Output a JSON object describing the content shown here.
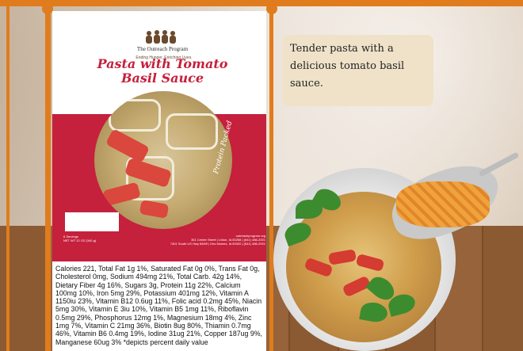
{
  "product": {
    "logo_name": "The Outreach Program",
    "logo_tagline": "Ending Hunger. Enriching Lives.",
    "title_line1": "Pasta with Tomato",
    "title_line2": "Basil Sauce",
    "side_label": "Protein Packed",
    "servings_text": "6 Servings",
    "net_weight": "NET WT 12 OZ (340 g)",
    "website": "outreachprogram.org",
    "address1": "301 Center Street | Union, IA 50258 | (641) 486-2001",
    "address2": "7401 South US Hwy 65/69 | Des Moines, IA 50320 | (641) 486-2001"
  },
  "nutrition_text": "Calories 221, Total Fat 1g 1%, Saturated Fat 0g 0%, Trans Fat 0g, Cholesterol 0mg, Sodium 494mg 21%, Total Carb. 42g 14%, Dietary Fiber 4g 16%, Sugars 3g, Protein 11g 22%, Calcium 100mg 10%, Iron 5mg 29%, Potassium 401mg 12%, Vitamin A 1150iu 23%, Vitamin B12 0.6ug 11%, Folic acid 0.2mg 45%, Niacin 5mg 30%, Vitamin E 3iu 10%, Vitamin B5 1mg 11%, Riboflavin 0.5mg 29%, Phosphorus 12mg 1%, Magnesium 18mg 4%, Zinc 1mg 7%, Vitamin C 21mg 36%, Biotin 8ug 80%, Thiamin 0.7mg 46%, Vitamin B6 0.4mg 19%, Iodine 31ug 21%, Copper 187ug 9%, Manganese 60ug 3% *depicts percent daily value",
  "note": {
    "text": "Tender pasta with a delicious tomato basil sauce."
  },
  "colors": {
    "frame": "#e07c1d",
    "brand_red": "#c5203c",
    "note_bg": "#efe2c9"
  }
}
